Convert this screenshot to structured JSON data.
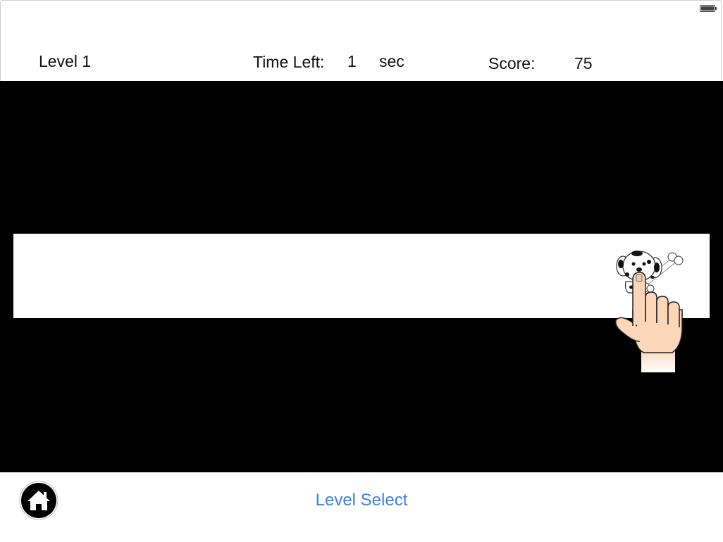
{
  "hud": {
    "level_label": "Level 1",
    "time_label": "Time Left:",
    "time_value": "1",
    "time_unit": "sec",
    "score_label": "Score:",
    "score_value": "75"
  },
  "footer": {
    "level_select_label": "Level Select"
  },
  "icons": {
    "home": "home-icon",
    "battery": "battery-icon",
    "dog": "dalmatian-dog-icon",
    "hand": "pointing-hand-icon"
  },
  "colors": {
    "background": "#ffffff",
    "play_area": "#000000",
    "lane": "#ffffff",
    "link": "#3b82e6"
  }
}
